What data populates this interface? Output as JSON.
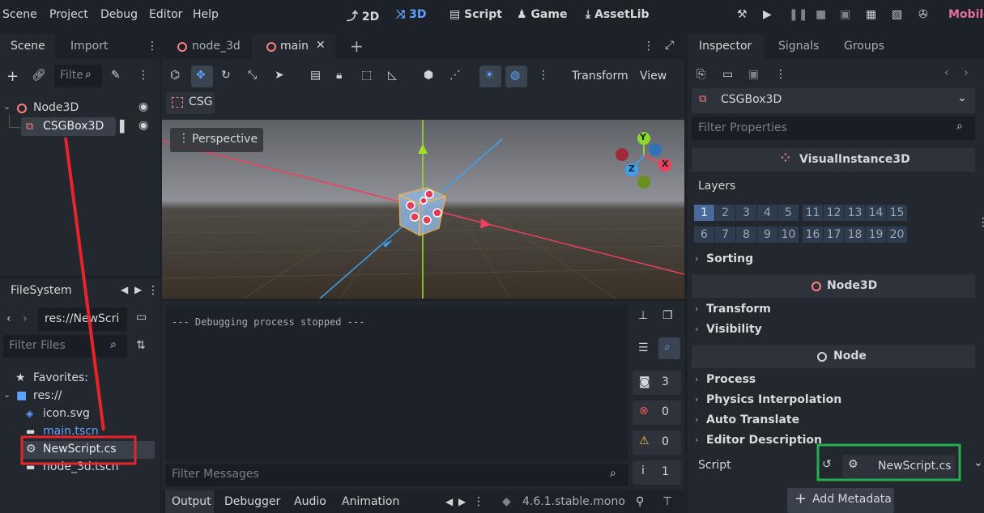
{
  "menubar": {
    "items": [
      "Scene",
      "Project",
      "Debug",
      "Editor",
      "Help"
    ],
    "workspaces": [
      "2D",
      "3D",
      "Script",
      "Game",
      "AssetLib"
    ],
    "renderer": "Mobile"
  },
  "scene_dock": {
    "tabs": [
      "Scene",
      "Import"
    ],
    "filter_placeholder": "Filter",
    "tree": [
      {
        "label": "Node3D",
        "type": "node3d"
      },
      {
        "label": "CSGBox3D",
        "type": "csgbox"
      }
    ]
  },
  "filesystem_dock": {
    "title": "FileSystem",
    "path": "res://NewScri",
    "filter_placeholder": "Filter Files",
    "items": [
      {
        "label": "Favorites:",
        "icon": "star-icon"
      },
      {
        "label": "res://",
        "icon": "folder-icon"
      },
      {
        "label": "icon.svg",
        "icon": "image-icon"
      },
      {
        "label": "main.tscn",
        "icon": "scene-icon"
      },
      {
        "label": "NewScript.cs",
        "icon": "gear-script-icon"
      },
      {
        "label": "node_3d.tscn",
        "icon": "scene-icon"
      }
    ]
  },
  "editor_tabs": [
    "node_3d",
    "main"
  ],
  "viewport": {
    "menus": [
      "Transform",
      "View"
    ],
    "csg_label": "CSG",
    "perspective_label": "Perspective",
    "gizmo_axes": [
      "Y",
      "X",
      "Z"
    ]
  },
  "output": {
    "log_line": "--- Debugging process stopped ---",
    "filter_placeholder": "Filter Messages",
    "counts": {
      "messages": "3",
      "errors": "0",
      "warnings": "0",
      "info": "1"
    },
    "bottom_tabs": [
      "Output",
      "Debugger",
      "Audio",
      "Animation"
    ],
    "version": "4.6.1.stable.mono"
  },
  "inspector": {
    "tabs": [
      "Inspector",
      "Signals",
      "Groups"
    ],
    "node_name": "CSGBox3D",
    "filter_placeholder": "Filter Properties",
    "visual_instance": "VisualInstance3D",
    "layers_label": "Layers",
    "layers": [
      "1",
      "2",
      "3",
      "4",
      "5",
      "6",
      "7",
      "8",
      "9",
      "10",
      "11",
      "12",
      "13",
      "14",
      "15",
      "16",
      "17",
      "18",
      "19",
      "20"
    ],
    "sorting_label": "Sorting",
    "node3d_label": "Node3D",
    "transform_label": "Transform",
    "visibility_label": "Visibility",
    "node_label": "Node",
    "process_label": "Process",
    "physics_label": "Physics Interpolation",
    "auto_translate_label": "Auto Translate",
    "editor_desc_label": "Editor Description",
    "script_label": "Script",
    "script_value": "NewScript.cs",
    "add_metadata_label": "Add Metadata"
  },
  "colors": {
    "accent": "#5fa3ff",
    "annotation_red": "#e8242a",
    "annotation_green": "#22b14c"
  }
}
